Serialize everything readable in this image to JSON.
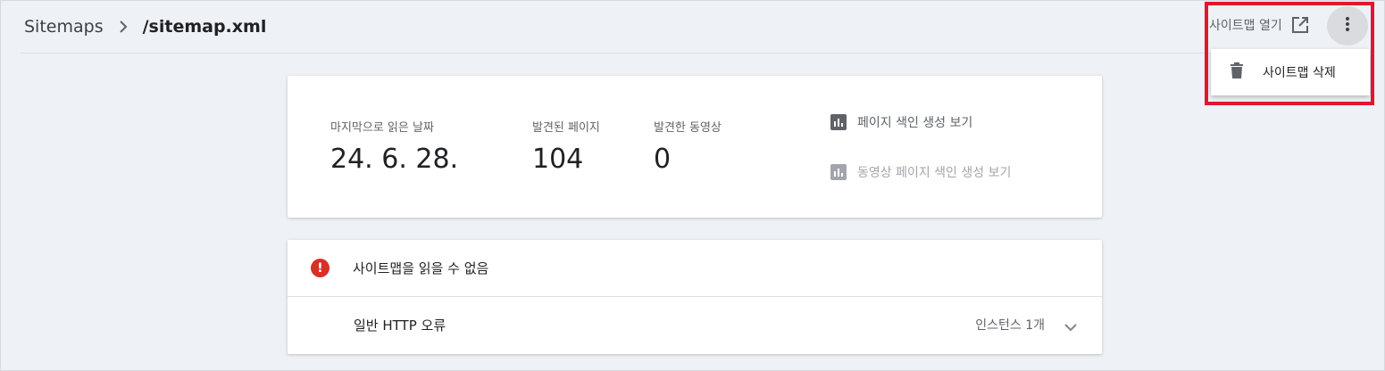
{
  "header": {
    "breadcrumb_root": "Sitemaps",
    "breadcrumb_current": "/sitemap.xml",
    "open_sitemap_label": "사이트맵 열기"
  },
  "menu": {
    "delete_label": "사이트맵 삭제"
  },
  "summary": {
    "last_read_label": "마지막으로 읽은 날짜",
    "last_read_value": "24. 6. 28.",
    "pages_label": "발견된 페이지",
    "pages_value": "104",
    "videos_label": "발견한 동영상",
    "videos_value": "0",
    "page_indexing_link": "페이지 색인 생성 보기",
    "video_indexing_link": "동영상 페이지 색인 생성 보기"
  },
  "errors": {
    "title": "사이트맵을 읽을 수 없음",
    "rows": [
      {
        "name": "일반 HTTP 오류",
        "count": "인스턴스 1개"
      }
    ]
  },
  "icons": {
    "separator": "chevron-right-icon",
    "open": "open-in-new-icon",
    "more": "more-vert-icon",
    "delete": "trash-icon",
    "report": "bar-chart-icon",
    "error": "error-icon",
    "expand": "chevron-down-icon"
  },
  "colors": {
    "background": "#eef1f6",
    "error": "#d93025",
    "highlight": "#e5142f",
    "muted": "#5f6368"
  }
}
